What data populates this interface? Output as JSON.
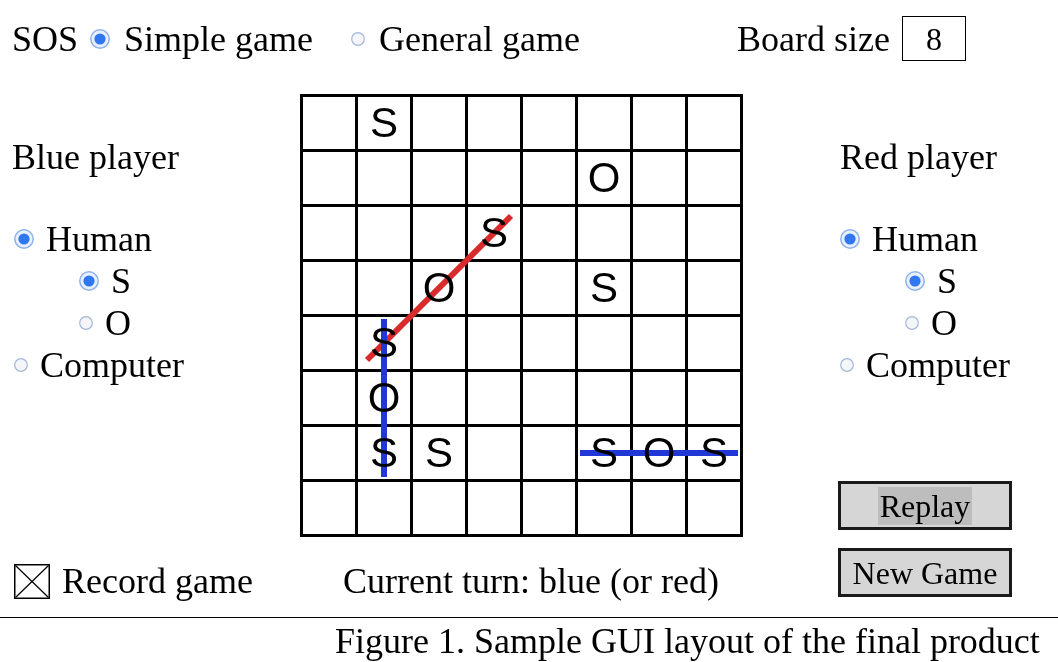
{
  "title": "SOS",
  "game_modes": [
    {
      "label": "Simple game",
      "selected": true
    },
    {
      "label": "General game",
      "selected": false
    }
  ],
  "board_size": {
    "label": "Board size",
    "value": "8"
  },
  "players": [
    {
      "title": "Blue player",
      "options": [
        {
          "label": "Human",
          "selected": true,
          "letters": [
            {
              "label": "S",
              "selected": true
            },
            {
              "label": "O",
              "selected": false
            }
          ]
        },
        {
          "label": "Computer",
          "selected": false
        }
      ]
    },
    {
      "title": "Red player",
      "options": [
        {
          "label": "Human",
          "selected": true,
          "letters": [
            {
              "label": "S",
              "selected": true
            },
            {
              "label": "O",
              "selected": false
            }
          ]
        },
        {
          "label": "Computer",
          "selected": false
        }
      ]
    }
  ],
  "board": {
    "rows": [
      [
        null,
        {
          "letter": "S"
        },
        null,
        null,
        null,
        null,
        null,
        null
      ],
      [
        null,
        null,
        null,
        null,
        null,
        {
          "letter": "O"
        },
        null,
        null
      ],
      [
        null,
        null,
        null,
        {
          "letter": "S"
        },
        null,
        null,
        null,
        null
      ],
      [
        null,
        null,
        {
          "letter": "O",
          "sos_lines": [
            {
              "kind": "rising",
              "color": "#d92b2b"
            }
          ]
        },
        null,
        null,
        {
          "letter": "S"
        },
        null,
        null
      ],
      [
        null,
        {
          "letter": "S"
        },
        null,
        null,
        null,
        null,
        null,
        null
      ],
      [
        null,
        {
          "letter": "O",
          "sos_lines": [
            {
              "kind": "vertical",
              "color": "#2238d6"
            }
          ]
        },
        null,
        null,
        null,
        null,
        null,
        null
      ],
      [
        null,
        {
          "letter": "S"
        },
        {
          "letter": "S"
        },
        null,
        null,
        {
          "letter": "S"
        },
        {
          "letter": "O",
          "sos_lines": [
            {
              "kind": "horizontal",
              "color": "#2238d6"
            }
          ]
        },
        {
          "letter": "S"
        }
      ],
      [
        null,
        null,
        null,
        null,
        null,
        null,
        null,
        null
      ]
    ]
  },
  "record_game": {
    "label": "Record game",
    "checked": true
  },
  "current_turn": "Current turn: blue (or red)",
  "buttons": [
    {
      "label": "Replay",
      "highlighted": true
    },
    {
      "label": "New Game",
      "highlighted": false
    }
  ],
  "caption": "Figure 1. Sample GUI layout of the final product"
}
